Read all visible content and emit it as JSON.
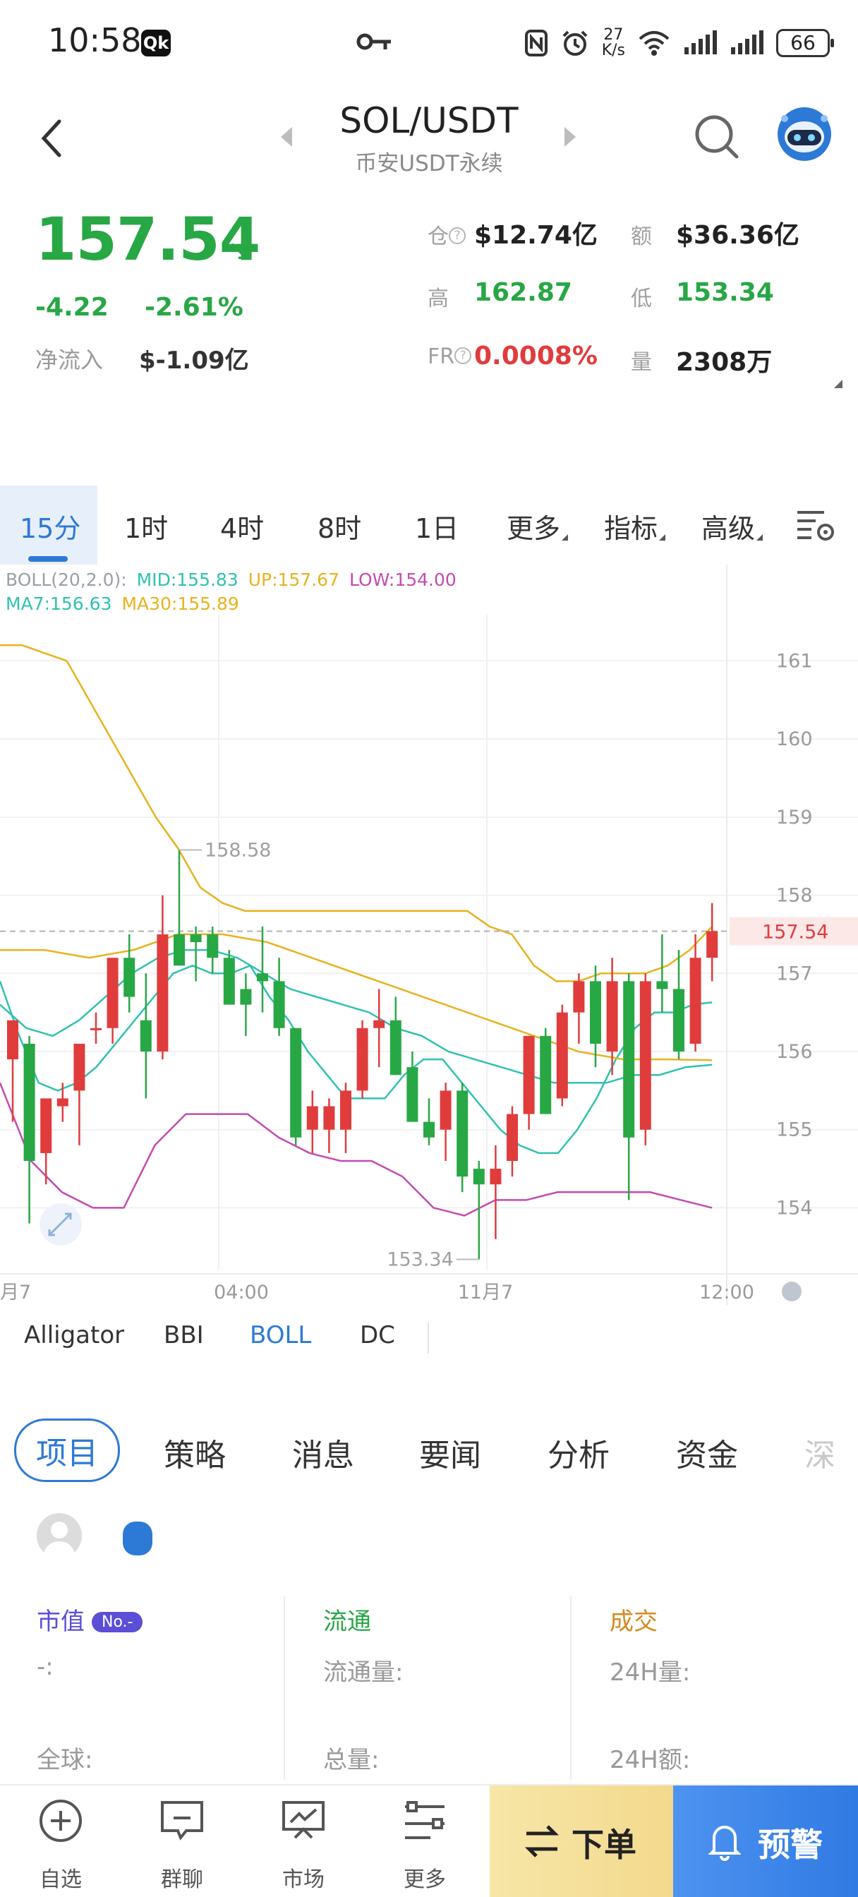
{
  "status_bar": {
    "time": "10:58",
    "app_badge": "Qk",
    "net_speed_top": "27",
    "net_speed_bottom": "K/s",
    "battery": "66"
  },
  "header": {
    "pair": "SOL/USDT",
    "exchange": "币安USDT永续"
  },
  "price": {
    "last": "157.54",
    "change_abs": "-4.22",
    "change_pct": "-2.61%",
    "net_inflow_label": "净流入",
    "net_inflow_value": "$-1.09亿",
    "color_down": "#28a745",
    "color_up": "#e03c3c"
  },
  "stats": {
    "oi_label": "仓",
    "oi_value": "$12.74亿",
    "amount_label": "额",
    "amount_value": "$36.36亿",
    "high_label": "高",
    "high_value": "162.87",
    "low_label": "低",
    "low_value": "153.34",
    "fr_label": "FR",
    "fr_value": "0.0008%",
    "vol_label": "量",
    "vol_value": "2308万"
  },
  "timeframes": [
    "15分",
    "1时",
    "4时",
    "8时",
    "1日",
    "更多",
    "指标",
    "高级"
  ],
  "active_timeframe": "15分",
  "legend": {
    "boll": "BOLL(20,2.0):",
    "mid": "MID:155.83",
    "up": "UP:157.67",
    "low": "LOW:154.00",
    "ma7": "MA7:156.63",
    "ma30": "MA30:155.89"
  },
  "chart_data": {
    "type": "candlestick",
    "y_ticks": [
      "161",
      "160",
      "159",
      "158",
      "157",
      "156",
      "155",
      "154"
    ],
    "y_range": [
      153.2,
      161.6
    ],
    "x_tick_labels": [
      "月7",
      "04:00",
      "11月7",
      "12:00"
    ],
    "current_price_tag": "157.54",
    "high_marker": "158.58",
    "low_marker": "153.34",
    "candles": [
      {
        "o": 155.9,
        "h": 156.3,
        "l": 155.1,
        "c": 156.4
      },
      {
        "o": 156.1,
        "h": 156.2,
        "l": 153.8,
        "c": 154.6
      },
      {
        "o": 154.7,
        "h": 155.2,
        "l": 154.3,
        "c": 155.4
      },
      {
        "o": 155.3,
        "h": 155.6,
        "l": 155.1,
        "c": 155.4
      },
      {
        "o": 155.5,
        "h": 156.0,
        "l": 154.8,
        "c": 156.1
      },
      {
        "o": 156.3,
        "h": 156.5,
        "l": 156.1,
        "c": 156.3
      },
      {
        "o": 156.3,
        "h": 157.0,
        "l": 156.1,
        "c": 157.2
      },
      {
        "o": 157.2,
        "h": 157.5,
        "l": 156.5,
        "c": 156.7
      },
      {
        "o": 156.4,
        "h": 157.0,
        "l": 155.4,
        "c": 156.0
      },
      {
        "o": 156.0,
        "h": 158.0,
        "l": 155.9,
        "c": 157.5
      },
      {
        "o": 157.5,
        "h": 158.58,
        "l": 157.1,
        "c": 157.1
      },
      {
        "o": 157.5,
        "h": 157.6,
        "l": 156.9,
        "c": 157.4
      },
      {
        "o": 157.5,
        "h": 157.6,
        "l": 157.0,
        "c": 157.2
      },
      {
        "o": 157.2,
        "h": 157.3,
        "l": 156.6,
        "c": 156.6
      },
      {
        "o": 156.8,
        "h": 157.0,
        "l": 156.2,
        "c": 156.6
      },
      {
        "o": 157.0,
        "h": 157.6,
        "l": 156.5,
        "c": 156.9
      },
      {
        "o": 156.9,
        "h": 157.2,
        "l": 156.2,
        "c": 156.3
      },
      {
        "o": 156.3,
        "h": 156.3,
        "l": 154.8,
        "c": 154.9
      },
      {
        "o": 155.0,
        "h": 155.5,
        "l": 154.7,
        "c": 155.3
      },
      {
        "o": 155.0,
        "h": 155.4,
        "l": 154.7,
        "c": 155.3
      },
      {
        "o": 155.0,
        "h": 155.6,
        "l": 154.7,
        "c": 155.5
      },
      {
        "o": 155.5,
        "h": 156.4,
        "l": 155.4,
        "c": 156.3
      },
      {
        "o": 156.3,
        "h": 156.8,
        "l": 155.8,
        "c": 156.4
      },
      {
        "o": 156.4,
        "h": 156.7,
        "l": 155.7,
        "c": 155.7
      },
      {
        "o": 155.8,
        "h": 156.0,
        "l": 155.1,
        "c": 155.1
      },
      {
        "o": 155.1,
        "h": 155.4,
        "l": 154.8,
        "c": 154.9
      },
      {
        "o": 155.0,
        "h": 155.6,
        "l": 154.6,
        "c": 155.5
      },
      {
        "o": 155.5,
        "h": 155.6,
        "l": 154.2,
        "c": 154.4
      },
      {
        "o": 154.5,
        "h": 154.6,
        "l": 153.34,
        "c": 154.3
      },
      {
        "o": 154.3,
        "h": 154.8,
        "l": 153.6,
        "c": 154.5
      },
      {
        "o": 154.6,
        "h": 155.3,
        "l": 154.4,
        "c": 155.2
      },
      {
        "o": 155.2,
        "h": 156.2,
        "l": 155.0,
        "c": 156.2
      },
      {
        "o": 156.2,
        "h": 156.3,
        "l": 155.2,
        "c": 155.2
      },
      {
        "o": 155.4,
        "h": 156.6,
        "l": 155.3,
        "c": 156.5
      },
      {
        "o": 156.5,
        "h": 157.0,
        "l": 156.1,
        "c": 156.9
      },
      {
        "o": 156.9,
        "h": 157.1,
        "l": 155.8,
        "c": 156.1
      },
      {
        "o": 156.0,
        "h": 157.2,
        "l": 155.7,
        "c": 156.9
      },
      {
        "o": 156.9,
        "h": 157.0,
        "l": 154.1,
        "c": 154.9
      },
      {
        "o": 155.0,
        "h": 157.0,
        "l": 154.8,
        "c": 156.9
      },
      {
        "o": 156.9,
        "h": 157.5,
        "l": 156.5,
        "c": 156.8
      },
      {
        "o": 156.8,
        "h": 157.3,
        "l": 155.9,
        "c": 156.0
      },
      {
        "o": 156.1,
        "h": 157.5,
        "l": 156.0,
        "c": 157.2
      },
      {
        "o": 157.2,
        "h": 157.9,
        "l": 156.9,
        "c": 157.54
      }
    ],
    "series": [
      {
        "name": "UP",
        "color": "#e8b21e",
        "values": [
          161.2,
          161.2,
          161.1,
          161.0,
          160.5,
          160.0,
          159.5,
          159.0,
          158.6,
          158.1,
          157.9,
          157.8,
          157.8,
          157.8,
          157.8,
          157.8,
          157.8,
          157.8,
          157.8,
          157.8,
          157.8,
          157.8,
          157.6,
          157.5,
          157.1,
          156.9,
          156.9,
          157.0,
          157.0,
          157.0,
          157.1,
          157.3,
          157.6
        ]
      },
      {
        "name": "MID",
        "color": "#2fc1b1",
        "values": [
          156.6,
          156.3,
          156.2,
          156.4,
          156.7,
          157.0,
          157.2,
          157.3,
          157.3,
          157.2,
          157.0,
          156.8,
          156.7,
          156.6,
          156.5,
          156.3,
          156.2,
          156.0,
          155.9,
          155.8,
          155.7,
          155.6,
          155.6,
          155.6,
          155.7,
          155.7,
          155.8,
          155.83
        ]
      },
      {
        "name": "LOW",
        "color": "#c44bb1",
        "values": [
          155.6,
          154.6,
          154.2,
          154.0,
          154.0,
          154.8,
          155.2,
          155.2,
          155.2,
          154.9,
          154.7,
          154.6,
          154.6,
          154.4,
          154.0,
          153.9,
          154.1,
          154.1,
          154.2,
          154.2,
          154.2,
          154.2,
          154.1,
          154.0
        ]
      },
      {
        "name": "MA7",
        "color": "#2fc1b1",
        "values": [
          156.9,
          156.2,
          155.6,
          155.5,
          155.6,
          155.8,
          156.1,
          156.4,
          156.7,
          157.0,
          157.1,
          157.0,
          157.0,
          157.1,
          156.7,
          156.4,
          156.0,
          155.7,
          155.4,
          155.4,
          155.4,
          155.7,
          155.9,
          155.9,
          155.6,
          155.3,
          155.0,
          154.8,
          154.7,
          154.7,
          155.0,
          155.4,
          155.9,
          156.3,
          156.5,
          156.5,
          156.6,
          156.63
        ]
      },
      {
        "name": "MA30",
        "color": "#e8b21e",
        "values": [
          157.3,
          157.3,
          157.2,
          157.3,
          157.5,
          157.5,
          157.4,
          157.2,
          157.0,
          156.8,
          156.6,
          156.4,
          156.2,
          156.0,
          155.9,
          155.9,
          155.89
        ]
      }
    ]
  },
  "indicators": [
    "Alligator",
    "BBI",
    "BOLL",
    "DC"
  ],
  "active_indicator": "BOLL",
  "info_tabs": [
    "项目",
    "策略",
    "消息",
    "要闻",
    "分析",
    "资金",
    "深"
  ],
  "active_info_tab": "项目",
  "project": {
    "market_cap_label": "市值",
    "rank_badge": "No.-",
    "market_cap_value": "-:",
    "global_label": "全球:",
    "circulation_label": "流通",
    "circulation_amount_label": "流通量:",
    "total_label": "总量:",
    "trade_label": "成交",
    "vol24_label": "24H量:",
    "amt24_label": "24H额:",
    "color_market": "#5a4fd6",
    "color_circ": "#28a745",
    "color_trade": "#d68a1e"
  },
  "bottom_nav": {
    "watchlist": "自选",
    "chat": "群聊",
    "market": "市场",
    "more": "更多",
    "order": "下单",
    "alert": "预警"
  }
}
